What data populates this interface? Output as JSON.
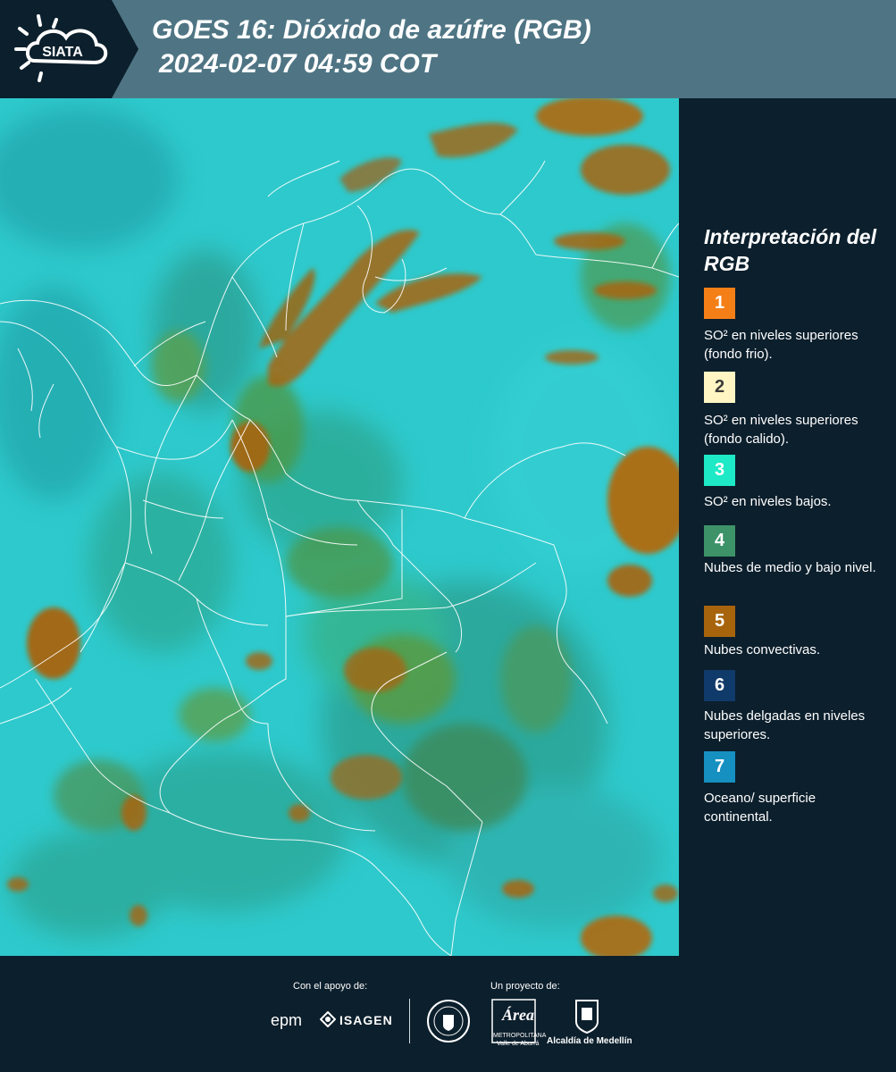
{
  "header": {
    "logo_text": "SIATA",
    "title_line1": "GOES 16: Dióxido de azúfre (RGB)",
    "title_line2": "2024-02-07 04:59 COT"
  },
  "legend": {
    "title": "Interpretación del RGB",
    "items": [
      {
        "number": "1",
        "color": "#f57f17",
        "description": "SO² en niveles superiores (fondo frio)."
      },
      {
        "number": "2",
        "color": "#fff6c4",
        "description": "SO² en niveles superiores (fondo calido)."
      },
      {
        "number": "3",
        "color": "#1de9c6",
        "description": "SO² en niveles bajos."
      },
      {
        "number": "4",
        "color": "#3d9268",
        "description": "Nubes de medio y bajo nivel."
      },
      {
        "number": "5",
        "color": "#a8640c",
        "description": "Nubes convectivas."
      },
      {
        "number": "6",
        "color": "#103a6a",
        "description": "Nubes delgadas en niveles superiores."
      },
      {
        "number": "7",
        "color": "#1590c0",
        "description": "Oceano/ superficie continental."
      }
    ]
  },
  "footer": {
    "support_label": "Con el apoyo de:",
    "project_label": "Un proyecto de:",
    "sponsor1": "epm",
    "sponsor2": "ISAGEN",
    "partner1_line1": "Área",
    "partner1_line2": "METROPOLITANA",
    "partner1_line3": "Valle de Aburrá",
    "partner2": "Alcaldía de Medellín"
  },
  "colors": {
    "background": "#0c1f2c",
    "header": "#4f7584",
    "ocean_cyan": "#2ec9cc",
    "cloud_brown": "#a8640c",
    "cloud_green": "#3d9268"
  }
}
